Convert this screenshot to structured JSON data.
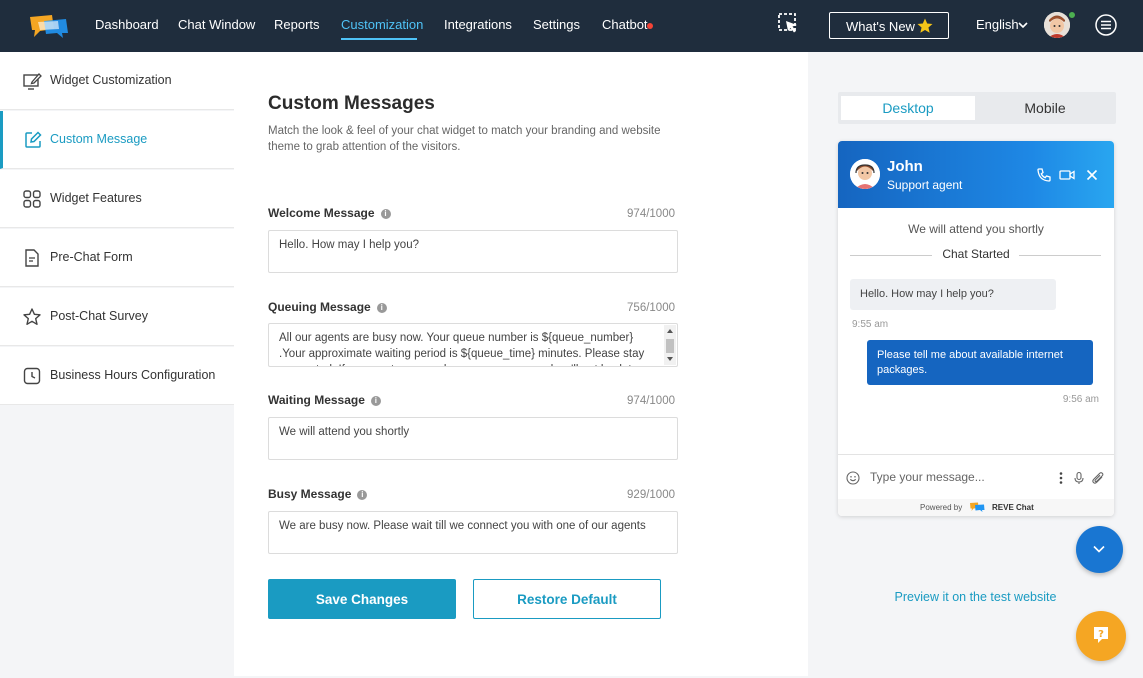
{
  "nav": {
    "items": [
      {
        "label": "Dashboard"
      },
      {
        "label": "Chat Window"
      },
      {
        "label": "Reports"
      },
      {
        "label": "Customization"
      },
      {
        "label": "Integrations"
      },
      {
        "label": "Settings"
      },
      {
        "label": "Chatbot"
      }
    ],
    "active": "Customization",
    "whats_new_label": "What's New",
    "language": "English"
  },
  "sidebar": {
    "items": [
      {
        "label": "Widget Customization",
        "icon": "widget-customization-icon"
      },
      {
        "label": "Custom Message",
        "icon": "edit-icon"
      },
      {
        "label": "Widget Features",
        "icon": "grid-icon"
      },
      {
        "label": "Pre-Chat Form",
        "icon": "form-icon"
      },
      {
        "label": "Post-Chat Survey",
        "icon": "star-icon"
      },
      {
        "label": "Business Hours Configuration",
        "icon": "clock-icon"
      }
    ],
    "active_index": 1
  },
  "main": {
    "title": "Custom Messages",
    "subtitle": "Match the look & feel of your chat widget to match your branding and website theme to grab attention of the visitors.",
    "fields": [
      {
        "label": "Welcome Message",
        "counter": "974/1000",
        "value": "Hello. How may I help you?"
      },
      {
        "label": "Queuing Message",
        "counter": "756/1000",
        "value": "All our agents are busy now. Your queue number is  ${queue_number} .Your approximate waiting period is  ${queue_time}  minutes. Please stay connected. If you want, you can leave a message and we'll get back to you."
      },
      {
        "label": "Waiting Message",
        "counter": "974/1000",
        "value": "We will attend you shortly"
      },
      {
        "label": "Busy Message",
        "counter": "929/1000",
        "value": "We are busy now. Please wait till we connect you with one of our agents"
      }
    ],
    "save_label": "Save Changes",
    "restore_label": "Restore Default"
  },
  "preview": {
    "tabs": [
      {
        "label": "Desktop"
      },
      {
        "label": "Mobile"
      }
    ],
    "active_tab": "Desktop",
    "chat": {
      "agent_name": "John",
      "agent_role": "Support agent",
      "attend_text": "We will attend you shortly",
      "started_text": "Chat Started",
      "incoming": {
        "text": "Hello. How may I help you?",
        "time": "9:55 am"
      },
      "outgoing": {
        "text": "Please tell me about available internet packages.",
        "time": "9:56 am"
      },
      "composer_placeholder": "Type your message...",
      "powered_by": "Powered by",
      "brand": "REVE Chat"
    },
    "preview_link": "Preview it on the test website"
  },
  "colors": {
    "topbar": "#1f2d3d",
    "accent": "#1a9bc2",
    "nav_active": "#4fc3f7",
    "chat_header": "#1565c0",
    "help_fab": "#f5a623"
  }
}
